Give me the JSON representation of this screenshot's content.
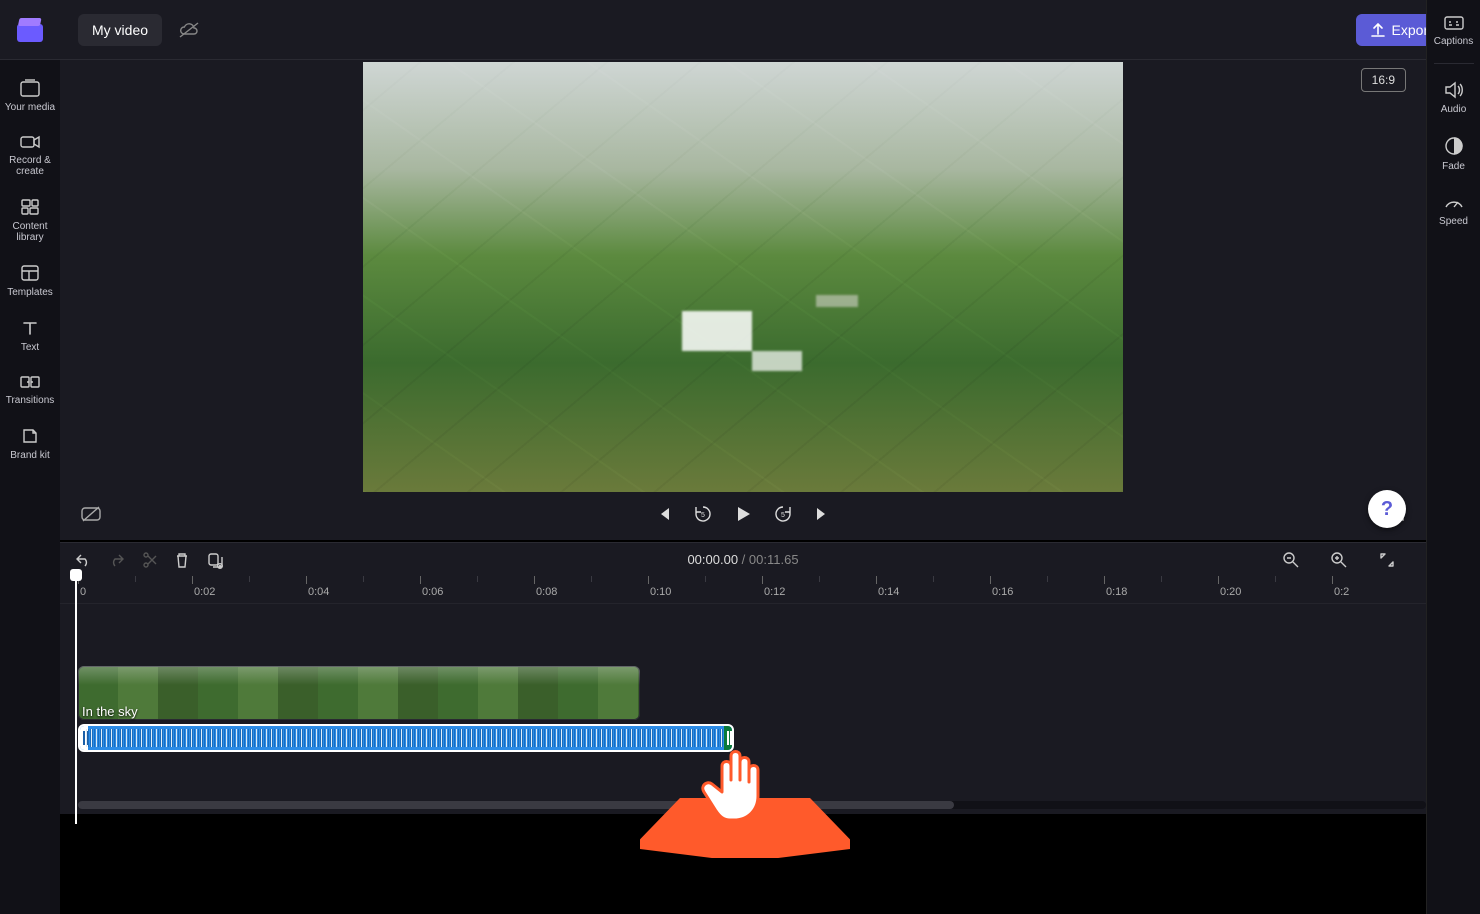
{
  "project_title": "My video",
  "export_label": "Export",
  "aspect_ratio": "16:9",
  "left_nav": {
    "your_media": "Your media",
    "record_create": "Record & create",
    "content_library": "Content library",
    "templates": "Templates",
    "text": "Text",
    "transitions": "Transitions",
    "brand_kit": "Brand kit"
  },
  "right_nav": {
    "captions": "Captions",
    "audio": "Audio",
    "fade": "Fade",
    "speed": "Speed"
  },
  "playback": {
    "current_time": "00:00.00",
    "total_time": "00:11.65"
  },
  "ruler_marks": [
    {
      "pos": 18,
      "label": "0"
    },
    {
      "pos": 132,
      "label": "0:02"
    },
    {
      "pos": 246,
      "label": "0:04"
    },
    {
      "pos": 360,
      "label": "0:06"
    },
    {
      "pos": 474,
      "label": "0:08"
    },
    {
      "pos": 588,
      "label": "0:10"
    },
    {
      "pos": 702,
      "label": "0:12"
    },
    {
      "pos": 816,
      "label": "0:14"
    },
    {
      "pos": 930,
      "label": "0:16"
    },
    {
      "pos": 1044,
      "label": "0:18"
    },
    {
      "pos": 1158,
      "label": "0:20"
    },
    {
      "pos": 1272,
      "label": "0:2"
    }
  ],
  "ruler_minors": [
    75,
    189,
    303,
    417,
    531,
    645,
    759,
    873,
    987,
    1101,
    1215
  ],
  "audio_clip_label": "In the sky",
  "help_label": "?"
}
